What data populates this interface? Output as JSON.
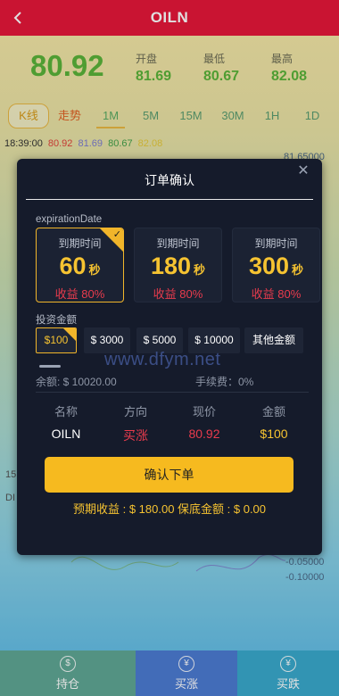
{
  "header": {
    "title": "OILN",
    "back_icon": "chevron-left-icon"
  },
  "quote": {
    "price": "80.92",
    "open_label": "开盘",
    "open_value": "81.69",
    "low_label": "最低",
    "low_value": "80.67",
    "high_label": "最高",
    "high_value": "82.08"
  },
  "tabs": [
    "K线",
    "走势",
    "1M",
    "5M",
    "15M",
    "30M",
    "1H",
    "1D"
  ],
  "timeline": {
    "time": "18:39:00",
    "v1": "80.92",
    "v2": "81.69",
    "v3": "80.67",
    "v4": "82.08"
  },
  "axis": {
    "top": "81.65000",
    "low1": "-0.05000",
    "low2": "-0.10000",
    "left1": "15",
    "left2": "DI"
  },
  "modal": {
    "title": "订单确认",
    "close_icon": "close-icon",
    "expiration_label": "expirationDate",
    "cards": [
      {
        "title": "到期时间",
        "num": "60",
        "unit": "秒",
        "profit": "收益 80%"
      },
      {
        "title": "到期时间",
        "num": "180",
        "unit": "秒",
        "profit": "收益 80%"
      },
      {
        "title": "到期时间",
        "num": "300",
        "unit": "秒",
        "profit": "收益 80%"
      }
    ],
    "investment_label": "投资金额",
    "amounts": [
      "$100",
      "$ 3000",
      "$ 5000",
      "$ 10000",
      "其他金额"
    ],
    "watermark": "www.dfym.net",
    "balance": "余额: $ 10020.00",
    "fee": "手续费：0%",
    "table": {
      "headers": [
        "名称",
        "方向",
        "现价",
        "金额"
      ],
      "values": [
        "OILN",
        "买涨",
        "80.92",
        "$100"
      ]
    },
    "confirm_label": "确认下单",
    "expected": "预期收益 : $ 180.00   保底金额 : $ 0.00"
  },
  "bottom": [
    {
      "label": "持仓",
      "icon": "wallet-icon"
    },
    {
      "label": "买涨",
      "icon": "yen-icon"
    },
    {
      "label": "买跌",
      "icon": "yen-icon"
    }
  ],
  "colors": {
    "header": "#e5173a",
    "accent": "#f6ba1f",
    "up": "#5ab33a",
    "down": "#e93b4d"
  }
}
